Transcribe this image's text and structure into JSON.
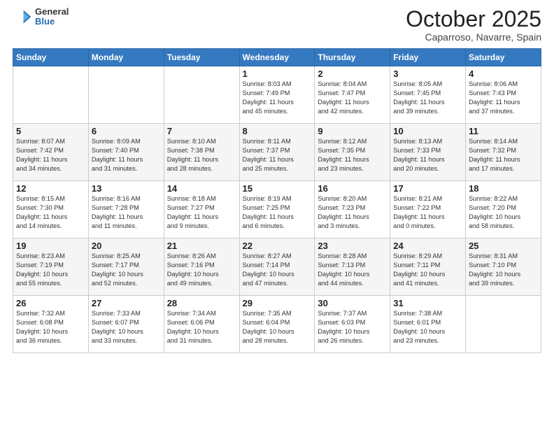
{
  "header": {
    "logo": {
      "general": "General",
      "blue": "Blue"
    },
    "title": "October 2025",
    "subtitle": "Caparroso, Navarre, Spain"
  },
  "weekdays": [
    "Sunday",
    "Monday",
    "Tuesday",
    "Wednesday",
    "Thursday",
    "Friday",
    "Saturday"
  ],
  "weeks": [
    [
      {
        "day": "",
        "info": ""
      },
      {
        "day": "",
        "info": ""
      },
      {
        "day": "",
        "info": ""
      },
      {
        "day": "1",
        "info": "Sunrise: 8:03 AM\nSunset: 7:49 PM\nDaylight: 11 hours\nand 45 minutes."
      },
      {
        "day": "2",
        "info": "Sunrise: 8:04 AM\nSunset: 7:47 PM\nDaylight: 11 hours\nand 42 minutes."
      },
      {
        "day": "3",
        "info": "Sunrise: 8:05 AM\nSunset: 7:45 PM\nDaylight: 11 hours\nand 39 minutes."
      },
      {
        "day": "4",
        "info": "Sunrise: 8:06 AM\nSunset: 7:43 PM\nDaylight: 11 hours\nand 37 minutes."
      }
    ],
    [
      {
        "day": "5",
        "info": "Sunrise: 8:07 AM\nSunset: 7:42 PM\nDaylight: 11 hours\nand 34 minutes."
      },
      {
        "day": "6",
        "info": "Sunrise: 8:09 AM\nSunset: 7:40 PM\nDaylight: 11 hours\nand 31 minutes."
      },
      {
        "day": "7",
        "info": "Sunrise: 8:10 AM\nSunset: 7:38 PM\nDaylight: 11 hours\nand 28 minutes."
      },
      {
        "day": "8",
        "info": "Sunrise: 8:11 AM\nSunset: 7:37 PM\nDaylight: 11 hours\nand 25 minutes."
      },
      {
        "day": "9",
        "info": "Sunrise: 8:12 AM\nSunset: 7:35 PM\nDaylight: 11 hours\nand 23 minutes."
      },
      {
        "day": "10",
        "info": "Sunrise: 8:13 AM\nSunset: 7:33 PM\nDaylight: 11 hours\nand 20 minutes."
      },
      {
        "day": "11",
        "info": "Sunrise: 8:14 AM\nSunset: 7:32 PM\nDaylight: 11 hours\nand 17 minutes."
      }
    ],
    [
      {
        "day": "12",
        "info": "Sunrise: 8:15 AM\nSunset: 7:30 PM\nDaylight: 11 hours\nand 14 minutes."
      },
      {
        "day": "13",
        "info": "Sunrise: 8:16 AM\nSunset: 7:28 PM\nDaylight: 11 hours\nand 11 minutes."
      },
      {
        "day": "14",
        "info": "Sunrise: 8:18 AM\nSunset: 7:27 PM\nDaylight: 11 hours\nand 9 minutes."
      },
      {
        "day": "15",
        "info": "Sunrise: 8:19 AM\nSunset: 7:25 PM\nDaylight: 11 hours\nand 6 minutes."
      },
      {
        "day": "16",
        "info": "Sunrise: 8:20 AM\nSunset: 7:23 PM\nDaylight: 11 hours\nand 3 minutes."
      },
      {
        "day": "17",
        "info": "Sunrise: 8:21 AM\nSunset: 7:22 PM\nDaylight: 11 hours\nand 0 minutes."
      },
      {
        "day": "18",
        "info": "Sunrise: 8:22 AM\nSunset: 7:20 PM\nDaylight: 10 hours\nand 58 minutes."
      }
    ],
    [
      {
        "day": "19",
        "info": "Sunrise: 8:23 AM\nSunset: 7:19 PM\nDaylight: 10 hours\nand 55 minutes."
      },
      {
        "day": "20",
        "info": "Sunrise: 8:25 AM\nSunset: 7:17 PM\nDaylight: 10 hours\nand 52 minutes."
      },
      {
        "day": "21",
        "info": "Sunrise: 8:26 AM\nSunset: 7:16 PM\nDaylight: 10 hours\nand 49 minutes."
      },
      {
        "day": "22",
        "info": "Sunrise: 8:27 AM\nSunset: 7:14 PM\nDaylight: 10 hours\nand 47 minutes."
      },
      {
        "day": "23",
        "info": "Sunrise: 8:28 AM\nSunset: 7:13 PM\nDaylight: 10 hours\nand 44 minutes."
      },
      {
        "day": "24",
        "info": "Sunrise: 8:29 AM\nSunset: 7:11 PM\nDaylight: 10 hours\nand 41 minutes."
      },
      {
        "day": "25",
        "info": "Sunrise: 8:31 AM\nSunset: 7:10 PM\nDaylight: 10 hours\nand 39 minutes."
      }
    ],
    [
      {
        "day": "26",
        "info": "Sunrise: 7:32 AM\nSunset: 6:08 PM\nDaylight: 10 hours\nand 36 minutes."
      },
      {
        "day": "27",
        "info": "Sunrise: 7:33 AM\nSunset: 6:07 PM\nDaylight: 10 hours\nand 33 minutes."
      },
      {
        "day": "28",
        "info": "Sunrise: 7:34 AM\nSunset: 6:06 PM\nDaylight: 10 hours\nand 31 minutes."
      },
      {
        "day": "29",
        "info": "Sunrise: 7:35 AM\nSunset: 6:04 PM\nDaylight: 10 hours\nand 28 minutes."
      },
      {
        "day": "30",
        "info": "Sunrise: 7:37 AM\nSunset: 6:03 PM\nDaylight: 10 hours\nand 26 minutes."
      },
      {
        "day": "31",
        "info": "Sunrise: 7:38 AM\nSunset: 6:01 PM\nDaylight: 10 hours\nand 23 minutes."
      },
      {
        "day": "",
        "info": ""
      }
    ]
  ]
}
